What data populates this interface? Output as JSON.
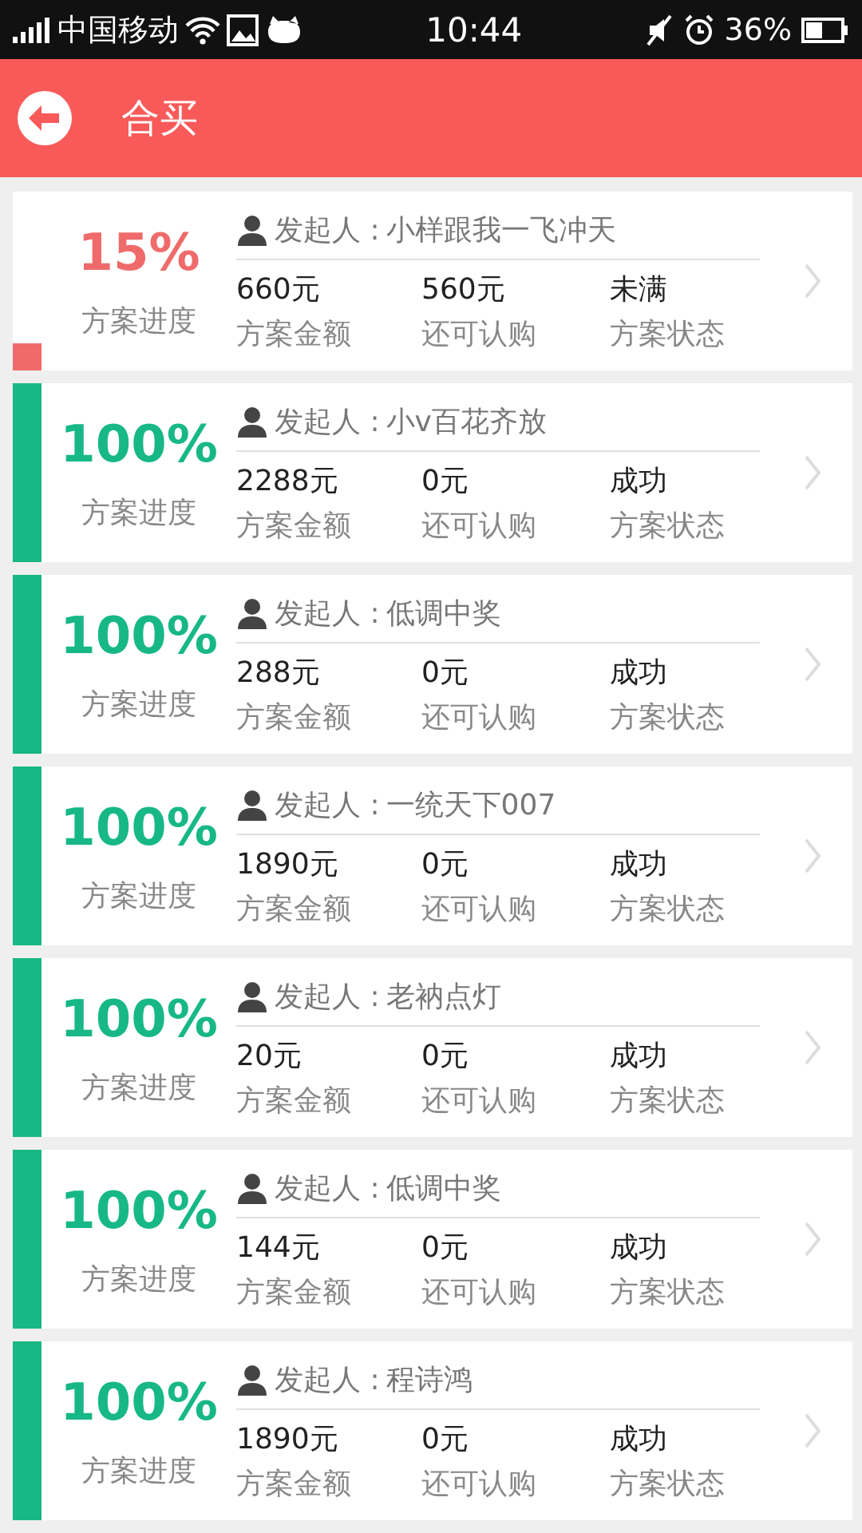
{
  "status_bar": {
    "carrier": "中国移动",
    "time": "10:44",
    "battery": "36%"
  },
  "header": {
    "title": "合买"
  },
  "plans": [
    {
      "progress": "15%",
      "level": 0.15,
      "progress_label": "方案进度",
      "initiator_label": "发起人 :",
      "initiator": "小样跟我一飞冲天",
      "amount": "660元",
      "amount_label": "方案金额",
      "remaining": "560元",
      "remaining_label": "还可认购",
      "status": "未满",
      "status_label": "方案状态"
    },
    {
      "progress": "100%",
      "level": 1,
      "progress_label": "方案进度",
      "initiator_label": "发起人 :",
      "initiator": "小v百花齐放",
      "amount": "2288元",
      "amount_label": "方案金额",
      "remaining": "0元",
      "remaining_label": "还可认购",
      "status": "成功",
      "status_label": "方案状态"
    },
    {
      "progress": "100%",
      "level": 1,
      "progress_label": "方案进度",
      "initiator_label": "发起人 :",
      "initiator": "低调中奖",
      "amount": "288元",
      "amount_label": "方案金额",
      "remaining": "0元",
      "remaining_label": "还可认购",
      "status": "成功",
      "status_label": "方案状态"
    },
    {
      "progress": "100%",
      "level": 1,
      "progress_label": "方案进度",
      "initiator_label": "发起人 :",
      "initiator": "一统天下007",
      "amount": "1890元",
      "amount_label": "方案金额",
      "remaining": "0元",
      "remaining_label": "还可认购",
      "status": "成功",
      "status_label": "方案状态"
    },
    {
      "progress": "100%",
      "level": 1,
      "progress_label": "方案进度",
      "initiator_label": "发起人 :",
      "initiator": "老衲点灯",
      "amount": "20元",
      "amount_label": "方案金额",
      "remaining": "0元",
      "remaining_label": "还可认购",
      "status": "成功",
      "status_label": "方案状态"
    },
    {
      "progress": "100%",
      "level": 1,
      "progress_label": "方案进度",
      "initiator_label": "发起人 :",
      "initiator": "低调中奖",
      "amount": "144元",
      "amount_label": "方案金额",
      "remaining": "0元",
      "remaining_label": "还可认购",
      "status": "成功",
      "status_label": "方案状态"
    },
    {
      "progress": "100%",
      "level": 1,
      "progress_label": "方案进度",
      "initiator_label": "发起人 :",
      "initiator": "程诗鸿",
      "amount": "1890元",
      "amount_label": "方案金额",
      "remaining": "0元",
      "remaining_label": "还可认购",
      "status": "成功",
      "status_label": "方案状态"
    }
  ]
}
